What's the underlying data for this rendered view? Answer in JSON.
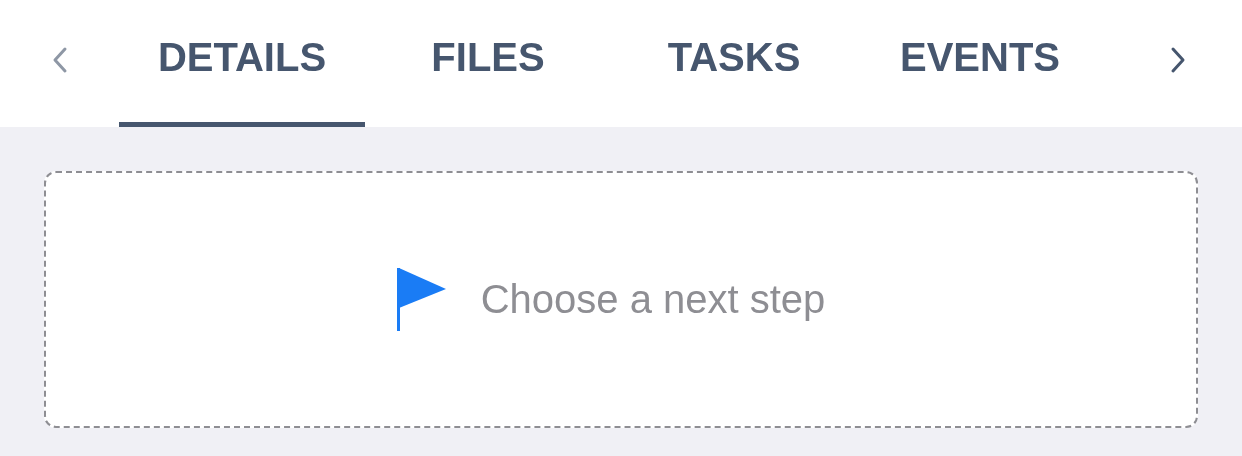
{
  "tab_bar": {
    "scroll_left": {
      "disabled": true
    },
    "scroll_right": {
      "disabled": false
    },
    "tabs": [
      {
        "label": "DETAILS",
        "selected": true
      },
      {
        "label": "FILES",
        "selected": false
      },
      {
        "label": "TASKS",
        "selected": false
      },
      {
        "label": "EVENTS",
        "selected": false
      }
    ]
  },
  "next_step": {
    "label": "Choose a next step"
  }
}
